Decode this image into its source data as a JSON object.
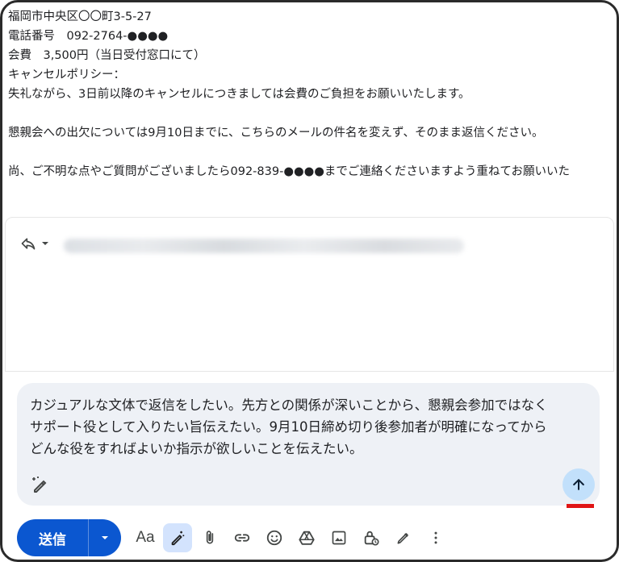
{
  "email": {
    "lines": [
      "福岡市中央区〇〇町3-5-27",
      "電話番号　092-2764-●●●●",
      "会費　3,500円（当日受付窓口にて）",
      "キャンセルポリシー：",
      "失礼ながら、3日前以降のキャンセルにつきましては会費のご負担をお願いいたします。",
      "",
      "懇親会への出欠については9月10日までに、こちらのメールの件名を変えず、そのまま返信ください。",
      "",
      "尚、ご不明な点やご質問がございましたら092-839-●●●●までご連絡くださいますよう重ねてお願いいた"
    ]
  },
  "reply": {
    "icon": "reply-icon",
    "dropdown_icon": "caret-down-icon"
  },
  "prompt": {
    "lines": [
      "カジュアルな文体で返信をしたい。先方との関係が深いことから、懇親会参加ではなく",
      "サポート役として入りたい旨伝えたい。9月10日締め切り後参加者が明確になってから",
      "どんな役をすればよいか指示が欲しいことを伝えたい。"
    ]
  },
  "toolbar": {
    "send_label": "送信",
    "format_label": "Aa"
  },
  "colors": {
    "send_blue": "#0b57d0",
    "prompt_bg": "#eef1f6",
    "arrow_bg": "#c2e0fb",
    "highlight_red": "#e01414"
  }
}
